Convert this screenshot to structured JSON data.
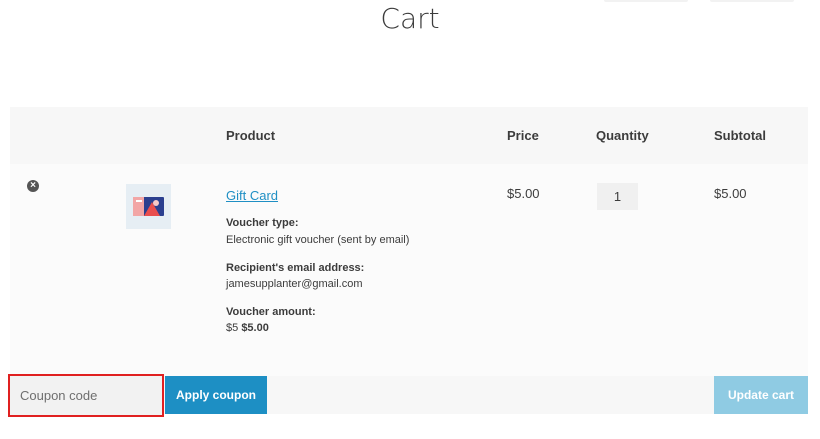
{
  "page": {
    "title": "Cart"
  },
  "table": {
    "headers": {
      "product": "Product",
      "price": "Price",
      "quantity": "Quantity",
      "subtotal": "Subtotal"
    },
    "items": [
      {
        "name": "Gift Card",
        "meta": {
          "voucher_type_label": "Voucher type:",
          "voucher_type_value": "Electronic gift voucher (sent by email)",
          "recipient_label": "Recipient's email address:",
          "recipient_value": "jamesupplanter@gmail.com",
          "amount_label": "Voucher amount:",
          "amount_base": "$5",
          "amount_value": "$5.00"
        },
        "price": "$5.00",
        "quantity": "1",
        "subtotal": "$5.00"
      }
    ]
  },
  "actions": {
    "coupon_placeholder": "Coupon code",
    "apply_coupon_label": "Apply coupon",
    "update_cart_label": "Update cart"
  },
  "colors": {
    "accent": "#1d8fc4",
    "accent_disabled": "#8fcbe3",
    "highlight": "#e02020"
  },
  "icons": {
    "remove": "remove-circle-x-icon"
  }
}
